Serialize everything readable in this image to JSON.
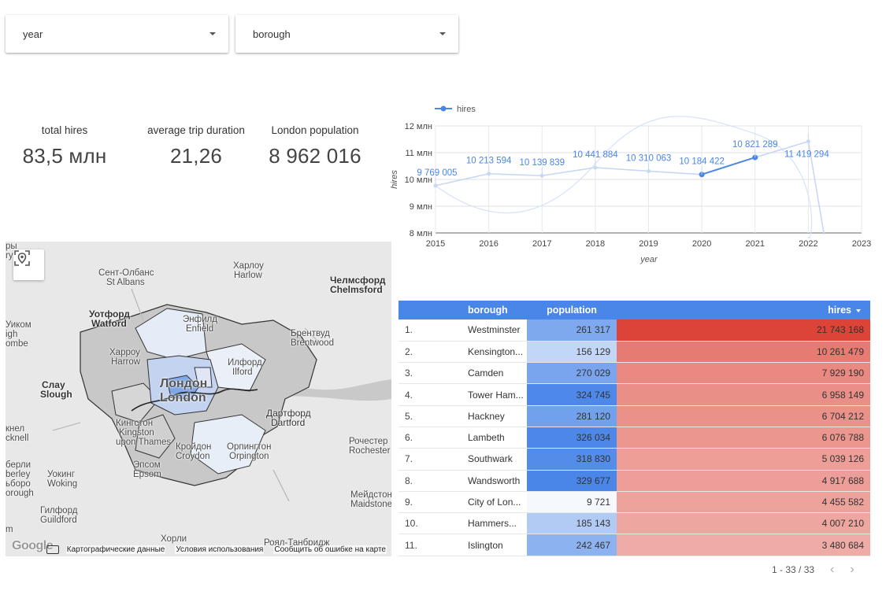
{
  "filters": {
    "year_label": "year",
    "borough_label": "borough"
  },
  "scorecards": {
    "total_hires": {
      "label": "total hires",
      "value": "83,5 млн"
    },
    "avg_duration": {
      "label": "average trip duration",
      "value": "21,26"
    },
    "population": {
      "label": "London population",
      "value": "8 962 016"
    }
  },
  "chart_data": {
    "type": "line",
    "legend": [
      "hires"
    ],
    "legend_position": "top-left",
    "x": [
      2015,
      2016,
      2017,
      2018,
      2019,
      2020,
      2021,
      2022
    ],
    "series": [
      {
        "name": "hires",
        "values": [
          9769005,
          10213594,
          10139839,
          10441884,
          10310063,
          10184422,
          10821289,
          11419294
        ],
        "labels": [
          "9 769 005",
          "10 213 594",
          "10 139 839",
          "10 441 884",
          "10 310 063",
          "10 184 422",
          "10 821 289",
          "11 419 294"
        ]
      }
    ],
    "xlabel": "year",
    "ylabel": "hires",
    "xlim": [
      2015,
      2023
    ],
    "ylim": [
      8000000,
      12000000
    ],
    "xticks": [
      "2015",
      "2016",
      "2017",
      "2018",
      "2019",
      "2020",
      "2021",
      "2022",
      "2023"
    ],
    "yticks": [
      "8 млн",
      "9 млн",
      "10 млн",
      "11 млн",
      "12 млн"
    ],
    "grid": true,
    "color": "#4a86e8"
  },
  "map": {
    "labels": {
      "st_albans_ru": "Сент-Олбанс",
      "st_albans": "St Albans",
      "harlow_ru": "Харлоу",
      "harlow": "Harlow",
      "chelmsford_ru": "Челмсфорд",
      "chelmsford": "Chelmsford",
      "watford_ru": "Уотфорд",
      "watford": "Watford",
      "enfield_ru": "Энфилд",
      "enfield": "Enfield",
      "brentwood_ru": "Брентвуд",
      "brentwood": "Brentwood",
      "harrow_ru": "Харроу",
      "harrow": "Harrow",
      "ilford_ru": "Илфорд",
      "ilford": "Ilford",
      "slough_ru": "Слау",
      "slough": "Slough",
      "london_ru": "Лондон",
      "london": "London",
      "kingston_ru": "Кингстон",
      "kingston": "Kingston",
      "upon_thames": "upon Thames",
      "croydon_ru": "Кройдон",
      "croydon": "Croydon",
      "orpington_ru": "Орпингтон",
      "orpington": "Orpington",
      "dartford_ru": "Дартфорд",
      "dartford": "Dartford",
      "rochester_ru": "Рочестер",
      "rochester": "Rochester",
      "epsom_ru": "Эпсом",
      "epsom": "Epsom",
      "woking_ru": "Уокинг",
      "woking": "Woking",
      "guildford_ru": "Гилфорд",
      "guildford": "Guildford",
      "maidstone_ru": "Мейдстон",
      "maidstone": "Maidstone",
      "horley_ru": "Хорли",
      "royal_tunbridge_ru": "Роял-Танбридж",
      "left_1": "Уиком",
      "left_2": "igh",
      "left_3": "ombe",
      "left_4": "кнел",
      "left_5": "cknell",
      "left_6": "берли",
      "left_7": "berley",
      "left_8": "ьборо",
      "left_9": "orough",
      "left_10": "m",
      "top_edge": "ры\nry"
    },
    "footer": {
      "map_data": "Картографические данные",
      "terms": "Условия использования",
      "report": "Сообщить об ошибке на карте",
      "logo": "Google"
    }
  },
  "table": {
    "headers": {
      "borough": "borough",
      "population": "population",
      "hires": "hires"
    },
    "rows": [
      {
        "idx": "1.",
        "borough": "Westminster",
        "population": "261 317",
        "hires": "21 743 168",
        "pop_v": 261317,
        "hires_v": 21743168
      },
      {
        "idx": "2.",
        "borough": "Kensington...",
        "population": "156 129",
        "hires": "10 261 479",
        "pop_v": 156129,
        "hires_v": 10261479
      },
      {
        "idx": "3.",
        "borough": "Camden",
        "population": "270 029",
        "hires": "7 929 190",
        "pop_v": 270029,
        "hires_v": 7929190
      },
      {
        "idx": "4.",
        "borough": "Tower Ham...",
        "population": "324 745",
        "hires": "6 958 149",
        "pop_v": 324745,
        "hires_v": 6958149
      },
      {
        "idx": "5.",
        "borough": "Hackney",
        "population": "281 120",
        "hires": "6 704 212",
        "pop_v": 281120,
        "hires_v": 6704212
      },
      {
        "idx": "6.",
        "borough": "Lambeth",
        "population": "326 034",
        "hires": "6 076 788",
        "pop_v": 326034,
        "hires_v": 6076788
      },
      {
        "idx": "7.",
        "borough": "Southwark",
        "population": "318 830",
        "hires": "5 039 126",
        "pop_v": 318830,
        "hires_v": 5039126
      },
      {
        "idx": "8.",
        "borough": "Wandsworth",
        "population": "329 677",
        "hires": "4 917 688",
        "pop_v": 329677,
        "hires_v": 4917688
      },
      {
        "idx": "9.",
        "borough": "City of Lon...",
        "population": "9 721",
        "hires": "4 455 582",
        "pop_v": 9721,
        "hires_v": 4455582
      },
      {
        "idx": "10.",
        "borough": "Hammers...",
        "population": "185 143",
        "hires": "4 007 210",
        "pop_v": 185143,
        "hires_v": 4007210
      },
      {
        "idx": "11.",
        "borough": "Islington",
        "population": "242 467",
        "hires": "3 480 684",
        "pop_v": 242467,
        "hires_v": 3480684
      }
    ],
    "pager": {
      "range": "1 - 33 / 33",
      "prev": "‹",
      "next": "›"
    },
    "colors": {
      "header": "#4a86e8",
      "pop_max": "#4a86e8",
      "hires_max": "#db4437"
    }
  }
}
